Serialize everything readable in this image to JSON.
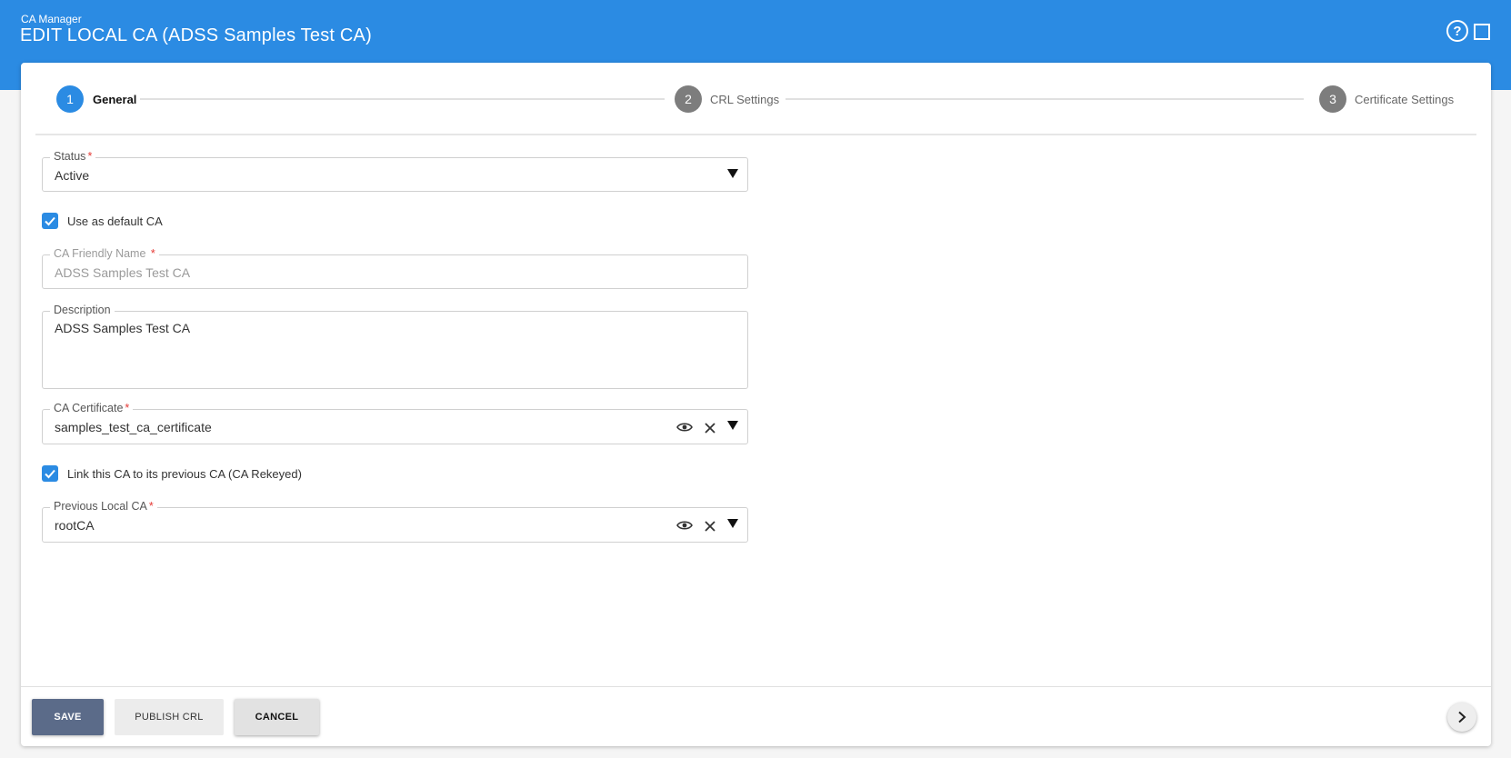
{
  "header": {
    "app_name": "CA Manager",
    "title": "EDIT LOCAL CA (ADSS Samples Test CA)",
    "help_icon": "help-circle-icon",
    "maximize_icon": "maximize-icon",
    "help_glyph": "?"
  },
  "stepper": {
    "steps": [
      {
        "number": "1",
        "label": "General",
        "active": true
      },
      {
        "number": "2",
        "label": "CRL Settings",
        "active": false
      },
      {
        "number": "3",
        "label": "Certificate Settings",
        "active": false
      }
    ],
    "active_color": "#2b8be3",
    "inactive_color": "#7d7d7d"
  },
  "form": {
    "status": {
      "label": "Status",
      "required_mark": "*",
      "value": "Active"
    },
    "use_default": {
      "label": "Use as default CA",
      "checked": true
    },
    "friendly_name": {
      "label": "CA Friendly Name",
      "required_mark": "*",
      "value": "ADSS Samples Test CA",
      "disabled": true
    },
    "description": {
      "label": "Description",
      "value": "ADSS Samples Test CA"
    },
    "ca_certificate": {
      "label": "CA Certificate",
      "required_mark": "*",
      "value": "samples_test_ca_certificate"
    },
    "link_previous": {
      "label": "Link this CA to its previous CA (CA Rekeyed)",
      "checked": true
    },
    "previous_ca": {
      "label": "Previous Local CA",
      "required_mark": "*",
      "value": "rootCA"
    }
  },
  "footer": {
    "save_label": "SAVE",
    "publish_label": "PUBLISH CRL",
    "cancel_label": "CANCEL",
    "next_icon": "chevron-right-icon"
  },
  "colors": {
    "header": "#2b8be3",
    "save_button": "#5b6b89",
    "required": "#e53935"
  }
}
